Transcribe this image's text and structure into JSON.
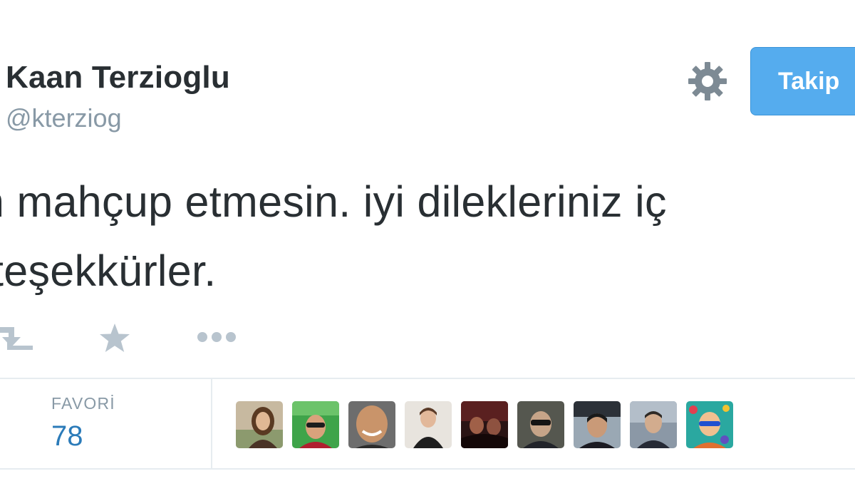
{
  "tweet": {
    "author": {
      "display_name": "Kaan Terzioglu",
      "handle": "@kterziog"
    },
    "follow_button_label": "Takip",
    "text_lines": [
      "n mahçup etmesin. iyi dilekleriniz iç",
      "teşekkürler."
    ],
    "actions": [
      "retweet-icon",
      "favorite-star-icon",
      "more-dots-icon"
    ],
    "stats": {
      "favorites_label": "FAVORİ",
      "favorites_count": "78"
    },
    "favoriters_count_shown": 9
  },
  "colors": {
    "follow_button": "#55acee",
    "name_text": "#292f33",
    "secondary_text": "#8899a6",
    "stat_value": "#2b7bb9",
    "action_icon": "#b8c4ce",
    "divider": "#e6ecf0"
  }
}
